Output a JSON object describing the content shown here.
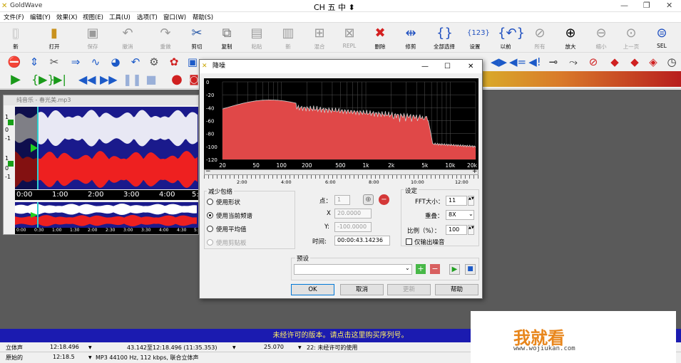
{
  "window": {
    "title": "GoldWave",
    "ime_indicator": "CH 五 中 ⬍",
    "controls": [
      "—",
      "❐",
      "✕"
    ]
  },
  "menu": [
    "文件(F)",
    "编辑(Y)",
    "效果(X)",
    "视图(E)",
    "工具(U)",
    "选项(T)",
    "窗口(W)",
    "帮助(S)"
  ],
  "toolbar": {
    "items": [
      {
        "label": "新",
        "icon": "new-file-icon",
        "enabled": true
      },
      {
        "label": "打开",
        "icon": "open-folder-icon",
        "enabled": true
      },
      {
        "label": "保存",
        "icon": "save-icon",
        "enabled": false
      },
      {
        "label": "撤消",
        "icon": "undo-icon",
        "enabled": false
      },
      {
        "label": "重做",
        "icon": "redo-icon",
        "enabled": false
      },
      {
        "label": "剪切",
        "icon": "scissors-icon",
        "enabled": true
      },
      {
        "label": "复制",
        "icon": "copy-icon",
        "enabled": true
      },
      {
        "label": "粘贴",
        "icon": "paste-icon",
        "enabled": false
      },
      {
        "label": "新",
        "icon": "paste-new-icon",
        "enabled": false
      },
      {
        "label": "混合",
        "icon": "mix-icon",
        "enabled": false
      },
      {
        "label": "REPL",
        "icon": "replace-icon",
        "enabled": false
      },
      {
        "label": "删除",
        "icon": "delete-icon",
        "enabled": true
      },
      {
        "label": "修剪",
        "icon": "trim-icon",
        "enabled": true
      },
      {
        "label": "全部选择",
        "icon": "select-all-icon",
        "enabled": true
      },
      {
        "label": "设置",
        "icon": "set-marker-icon",
        "enabled": true
      },
      {
        "label": "以前",
        "icon": "previous-icon",
        "enabled": true
      },
      {
        "label": "所有",
        "icon": "zoom-all-icon",
        "enabled": false
      },
      {
        "label": "放大",
        "icon": "zoom-in-icon",
        "enabled": true
      },
      {
        "label": "缩小",
        "icon": "zoom-out-icon",
        "enabled": false
      },
      {
        "label": "上一页",
        "icon": "previous-page-icon",
        "enabled": false
      },
      {
        "label": "SEL",
        "icon": "zoom-selection-icon",
        "enabled": true
      }
    ]
  },
  "wave_window": {
    "title": "纯音乐 - 春光美.mp3",
    "time_ticks": [
      "0:00",
      "1:00",
      "2:00",
      "3:00",
      "4:00",
      "5:0"
    ],
    "mini_ticks": [
      "0:00",
      "0:30",
      "1:00",
      "1:30",
      "2:00",
      "2:30",
      "3:00",
      "3:30",
      "4:00",
      "4:30",
      "5:"
    ],
    "channel_labels": [
      "1",
      "0",
      "-1",
      "1",
      "0",
      "-1"
    ]
  },
  "dialog": {
    "title": "降噪",
    "controls": [
      "—",
      "☐",
      "✕"
    ],
    "y_ticks": [
      "0",
      "-20",
      "-40",
      "-60",
      "-80",
      "-100",
      "-120"
    ],
    "x_ticks": [
      "20",
      "50",
      "100",
      "200",
      "500",
      "1k",
      "2k",
      "5k",
      "10k",
      "20k"
    ],
    "timeline_ticks": [
      "2:00",
      "4:00",
      "6:00",
      "8:00",
      "10:00",
      "12:00"
    ],
    "reduce_envelope": {
      "legend": "减少包络",
      "options": [
        {
          "label": "使用形状",
          "selected": false,
          "enabled": true
        },
        {
          "label": "使用当前频谱",
          "selected": true,
          "enabled": true
        },
        {
          "label": "使用平均值",
          "selected": false,
          "enabled": true
        },
        {
          "label": "使用剪贴板",
          "selected": false,
          "enabled": false
        }
      ]
    },
    "point": {
      "label": "点：",
      "value": "1",
      "x_label": "X",
      "x_value": "20.0000",
      "y_label": "Y:",
      "y_value": "-100.0000",
      "time_label": "时间:",
      "time_value": "00:00:43.14236"
    },
    "settings": {
      "legend": "设定",
      "fft_label": "FFT大小：",
      "fft_value": "11",
      "overlap_label": "重叠：",
      "overlap_value": "8X",
      "scale_label": "比例（%）：",
      "scale_value": "100",
      "noise_only_label": "仅输出噪音",
      "noise_only_checked": false
    },
    "preset": {
      "legend": "预设",
      "value": ""
    },
    "buttons": {
      "ok": "OK",
      "cancel": "取消",
      "update": "更新",
      "help": "帮助"
    }
  },
  "status": {
    "unregistered": "未经许可的版本。请点击这里购买序列号。",
    "row1": {
      "mode": "立体声",
      "length": "12:18.496",
      "selection": "43.142至12:18.496 (11:35.353)",
      "zoom": "25.070",
      "message": "22: 未经许可的使用"
    },
    "row2": {
      "kind": "原始的",
      "length": "12:18.5",
      "format": "MP3 44100 Hz, 112 kbps, 联合立体声"
    }
  },
  "watermark": {
    "brand": "我就看",
    "url": "www.wojiukan.com"
  },
  "colors": {
    "spectrum_fill": "#e04848",
    "wave_bg": "#1a1a8c",
    "status_bg": "#1b1bb0",
    "status_text": "#ffee66"
  }
}
